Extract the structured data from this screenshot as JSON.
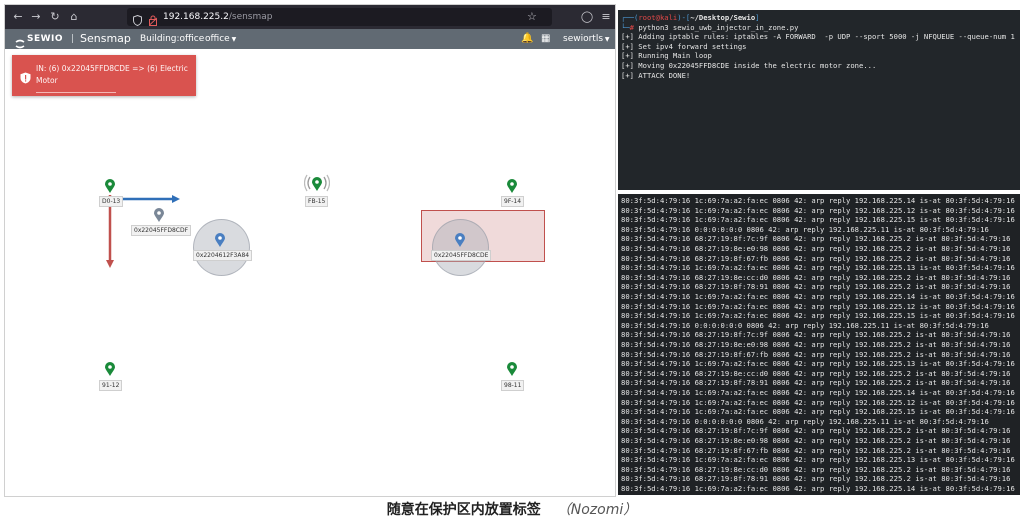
{
  "browser": {
    "url_host": "192.168.225.2",
    "url_path": "/sensmap"
  },
  "app": {
    "logo": "SEWIO",
    "product": "Sensmap",
    "building": "Building:office",
    "floor": "office",
    "user": "sewiortls"
  },
  "alert": {
    "text": "IN: (6) 0x22045FFD8CDE => (6) Electric Motor"
  },
  "map": {
    "anchors": [
      {
        "id": "D0-13"
      },
      {
        "id": "FB-15"
      },
      {
        "id": "9F-14"
      },
      {
        "id": "91-12"
      },
      {
        "id": "98-11"
      }
    ],
    "tags": [
      {
        "id": "0x22045FFD8CDF"
      },
      {
        "id": "0x2204612F3A84"
      },
      {
        "id": "0x22045FFD8CDE"
      }
    ]
  },
  "terminal_top": {
    "prompt_user": "root@kali",
    "prompt_path": "~/Desktop/Sewio",
    "command": "python3 sewio_uwb_injector_in_zone.py",
    "lines": [
      "[+] Adding iptable rules: iptables -A FORWARD  -p UDP --sport 5000 -j NFQUEUE --queue-num 1",
      "[+] Set ipv4 forward settings",
      "[+] Running Main loop",
      "[+] Moving 0x22045FFD8CDE inside the electric motor zone...",
      "[+] ATTACK DONE!"
    ]
  },
  "terminal_bottom": {
    "lines": [
      "80:3f:5d:4:79:16 1c:69:7a:a2:fa:ec 0806 42: arp reply 192.168.225.14 is-at 80:3f:5d:4:79:16",
      "80:3f:5d:4:79:16 1c:69:7a:a2:fa:ec 0806 42: arp reply 192.168.225.12 is-at 80:3f:5d:4:79:16",
      "80:3f:5d:4:79:16 1c:69:7a:a2:fa:ec 0806 42: arp reply 192.168.225.15 is-at 80:3f:5d:4:79:16",
      "80:3f:5d:4:79:16 0:0:0:0:0:0 0806 42: arp reply 192.168.225.11 is-at 80:3f:5d:4:79:16",
      "80:3f:5d:4:79:16 68:27:19:8f:7c:9f 0806 42: arp reply 192.168.225.2 is-at 80:3f:5d:4:79:16",
      "80:3f:5d:4:79:16 68:27:19:8e:e0:98 0806 42: arp reply 192.168.225.2 is-at 80:3f:5d:4:79:16",
      "80:3f:5d:4:79:16 68:27:19:8f:67:fb 0806 42: arp reply 192.168.225.2 is-at 80:3f:5d:4:79:16",
      "80:3f:5d:4:79:16 1c:69:7a:a2:fa:ec 0806 42: arp reply 192.168.225.13 is-at 80:3f:5d:4:79:16",
      "80:3f:5d:4:79:16 68:27:19:8e:cc:d0 0806 42: arp reply 192.168.225.2 is-at 80:3f:5d:4:79:16",
      "80:3f:5d:4:79:16 68:27:19:8f:78:91 0806 42: arp reply 192.168.225.2 is-at 80:3f:5d:4:79:16",
      "80:3f:5d:4:79:16 1c:69:7a:a2:fa:ec 0806 42: arp reply 192.168.225.14 is-at 80:3f:5d:4:79:16",
      "80:3f:5d:4:79:16 1c:69:7a:a2:fa:ec 0806 42: arp reply 192.168.225.12 is-at 80:3f:5d:4:79:16",
      "80:3f:5d:4:79:16 1c:69:7a:a2:fa:ec 0806 42: arp reply 192.168.225.15 is-at 80:3f:5d:4:79:16",
      "80:3f:5d:4:79:16 0:0:0:0:0:0 0806 42: arp reply 192.168.225.11 is-at 80:3f:5d:4:79:16",
      "80:3f:5d:4:79:16 68:27:19:8f:7c:9f 0806 42: arp reply 192.168.225.2 is-at 80:3f:5d:4:79:16",
      "80:3f:5d:4:79:16 68:27:19:8e:e0:98 0806 42: arp reply 192.168.225.2 is-at 80:3f:5d:4:79:16",
      "80:3f:5d:4:79:16 68:27:19:8f:67:fb 0806 42: arp reply 192.168.225.2 is-at 80:3f:5d:4:79:16",
      "80:3f:5d:4:79:16 1c:69:7a:a2:fa:ec 0806 42: arp reply 192.168.225.13 is-at 80:3f:5d:4:79:16",
      "80:3f:5d:4:79:16 68:27:19:8e:cc:d0 0806 42: arp reply 192.168.225.2 is-at 80:3f:5d:4:79:16",
      "80:3f:5d:4:79:16 68:27:19:8f:78:91 0806 42: arp reply 192.168.225.2 is-at 80:3f:5d:4:79:16",
      "80:3f:5d:4:79:16 1c:69:7a:a2:fa:ec 0806 42: arp reply 192.168.225.14 is-at 80:3f:5d:4:79:16",
      "80:3f:5d:4:79:16 1c:69:7a:a2:fa:ec 0806 42: arp reply 192.168.225.12 is-at 80:3f:5d:4:79:16",
      "80:3f:5d:4:79:16 1c:69:7a:a2:fa:ec 0806 42: arp reply 192.168.225.15 is-at 80:3f:5d:4:79:16",
      "80:3f:5d:4:79:16 0:0:0:0:0:0 0806 42: arp reply 192.168.225.11 is-at 80:3f:5d:4:79:16",
      "80:3f:5d:4:79:16 68:27:19:8f:7c:9f 0806 42: arp reply 192.168.225.2 is-at 80:3f:5d:4:79:16",
      "80:3f:5d:4:79:16 68:27:19:8e:e0:98 0806 42: arp reply 192.168.225.2 is-at 80:3f:5d:4:79:16",
      "80:3f:5d:4:79:16 68:27:19:8f:67:fb 0806 42: arp reply 192.168.225.2 is-at 80:3f:5d:4:79:16",
      "80:3f:5d:4:79:16 1c:69:7a:a2:fa:ec 0806 42: arp reply 192.168.225.13 is-at 80:3f:5d:4:79:16",
      "80:3f:5d:4:79:16 68:27:19:8e:cc:d0 0806 42: arp reply 192.168.225.2 is-at 80:3f:5d:4:79:16",
      "80:3f:5d:4:79:16 68:27:19:8f:78:91 0806 42: arp reply 192.168.225.2 is-at 80:3f:5d:4:79:16",
      "80:3f:5d:4:79:16 1c:69:7a:a2:fa:ec 0806 42: arp reply 192.168.225.14 is-at 80:3f:5d:4:79:16"
    ]
  },
  "caption": {
    "main": "随意在保护区内放置标签",
    "source": "（Nozomi）"
  },
  "colors": {
    "alert": "#d9534f",
    "zone_fill": "#e8c4c4",
    "zone_border": "#c0504d",
    "anchor_pin": "#1a8a3a",
    "tag_pin": "#4a7fc1",
    "arrow_x": "#2f6fb8",
    "arrow_y": "#c0504d",
    "appbar": "#616a73",
    "terminal_bg": "#22262a"
  }
}
